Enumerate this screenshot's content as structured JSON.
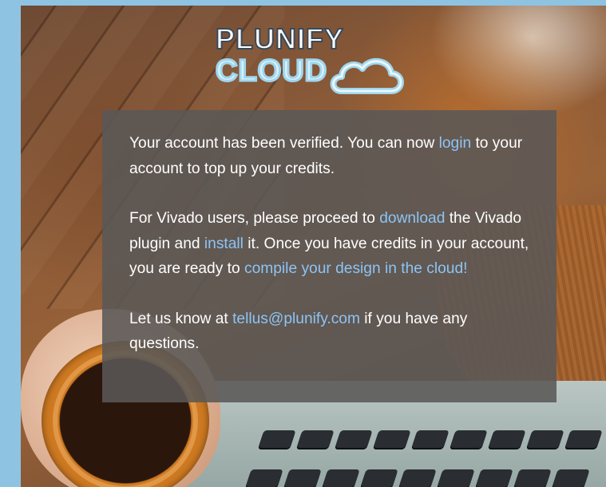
{
  "logo": {
    "line1": "PLUNIFY",
    "line2": "CLOUD",
    "cloud_icon": "cloud-icon",
    "colors": {
      "text_dark": "#3a4a5a",
      "text_light": "#d9f1fb",
      "accent_blue": "#9fd6ee"
    }
  },
  "message": {
    "p1_before": "Your account has been verified. You can now ",
    "p1_link": "login",
    "p1_after": " to your account to top up your credits.",
    "p2_before": "For Vivado users, please proceed to ",
    "p2_link1": "download",
    "p2_mid1": " the Vivado plugin and ",
    "p2_link2": "install",
    "p2_mid2": " it. Once you have credits in your account, you are ready to ",
    "p2_link3": "compile your design in the cloud!",
    "p3_before": "Let us know at ",
    "p3_link": "tellus@plunify.com",
    "p3_after": " if you have any questions."
  },
  "colors": {
    "link": "#8cc4f5",
    "panel_bg": "#5a5856",
    "page_border": "#8fc3e2"
  }
}
